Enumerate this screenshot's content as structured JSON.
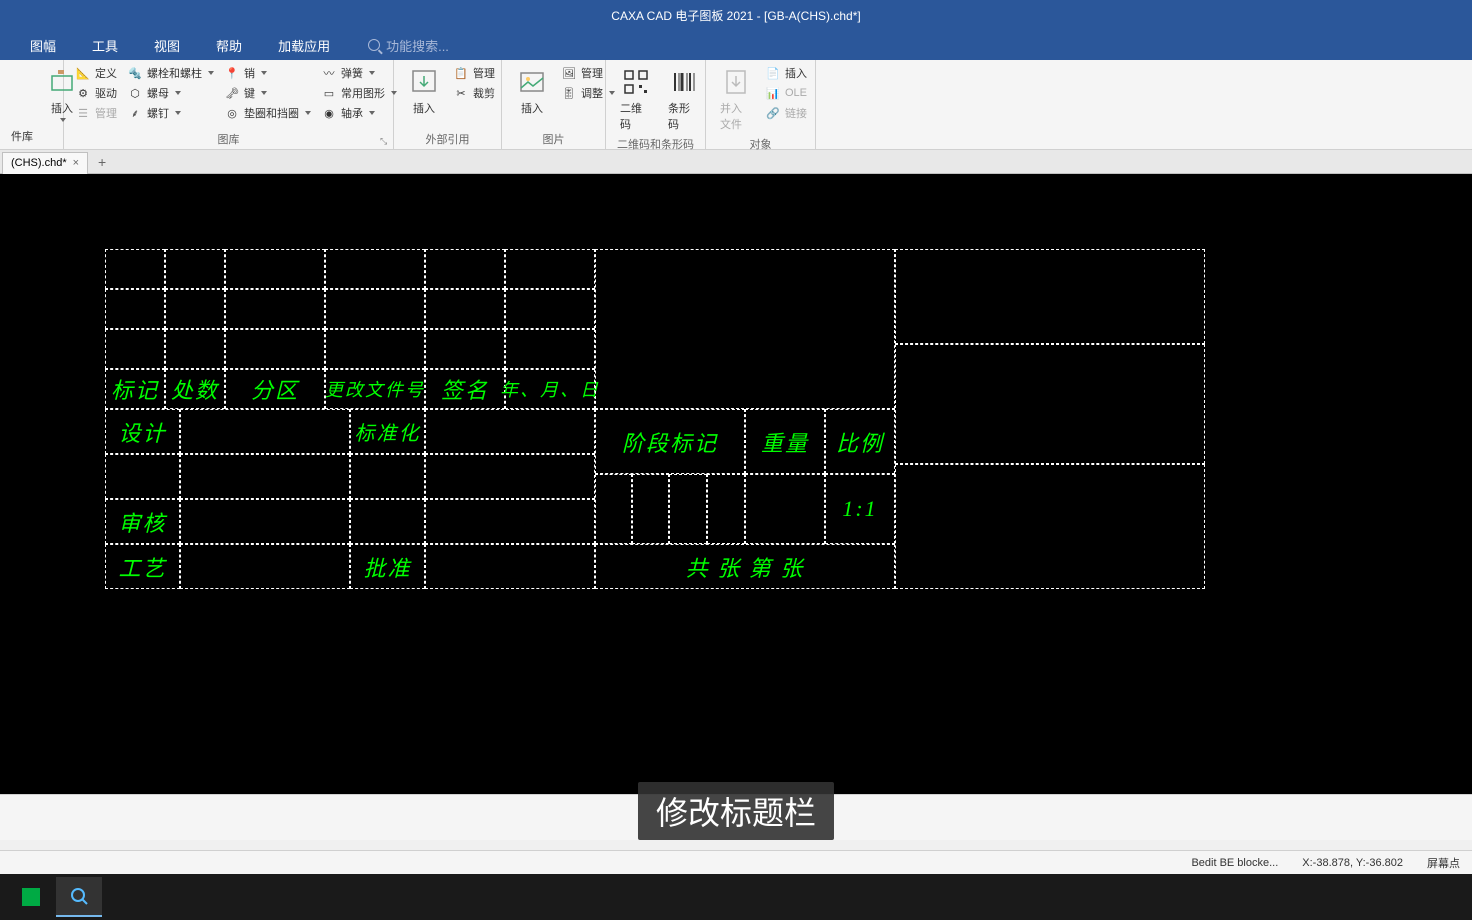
{
  "app": {
    "title": "CAXA CAD 电子图板 2021 - [GB-A(CHS).chd*]"
  },
  "menu": {
    "items": [
      "图幅",
      "工具",
      "视图",
      "帮助",
      "加载应用"
    ],
    "search_placeholder": "功能搜索..."
  },
  "ribbon": {
    "group0": {
      "label": "",
      "lib": "件库",
      "insert": "插入"
    },
    "group1": {
      "label": "图库",
      "define": "定义",
      "drive": "驱动",
      "manage": "管理",
      "bolt": "螺栓和螺柱",
      "nut": "螺母",
      "nail": "螺钉",
      "pin": "销",
      "key": "键",
      "washer": "垫圈和挡圈",
      "spring": "弹簧",
      "shape": "常用图形",
      "bearing": "轴承"
    },
    "group2": {
      "label": "外部引用",
      "insert": "插入",
      "manage": "管理",
      "crop": "裁剪"
    },
    "group3": {
      "label": "图片",
      "insert": "插入",
      "manage": "管理",
      "adjust": "调整"
    },
    "group4": {
      "label": "二维码和条形码",
      "qrcode": "二维码",
      "barcode": "条形码"
    },
    "group5": {
      "label": "对象",
      "merge": "并入文件",
      "insert": "插入",
      "ole": "OLE",
      "link": "链接"
    }
  },
  "tabs": {
    "doc1": "(CHS).chd*"
  },
  "drawing": {
    "row4": {
      "c1": "标记",
      "c2": "处数",
      "c3": "分区",
      "c4": "更改文件号",
      "c5": "签名",
      "c6": "年、月、日"
    },
    "row5": {
      "c1": "设计",
      "c3": "标准化",
      "m1": "阶段标记",
      "m2": "重量",
      "m3": "比例"
    },
    "row6": {
      "m3": "1:1"
    },
    "row7": {
      "c1": "审核"
    },
    "row8": {
      "c1": "工艺",
      "c3": "批准",
      "m": "共    张    第    张"
    }
  },
  "status": {
    "bedit": "Bedit BE blocke...",
    "coords": "X:-38.878, Y:-36.802",
    "screen": "屏幕点"
  },
  "overlay": "修改标题栏"
}
